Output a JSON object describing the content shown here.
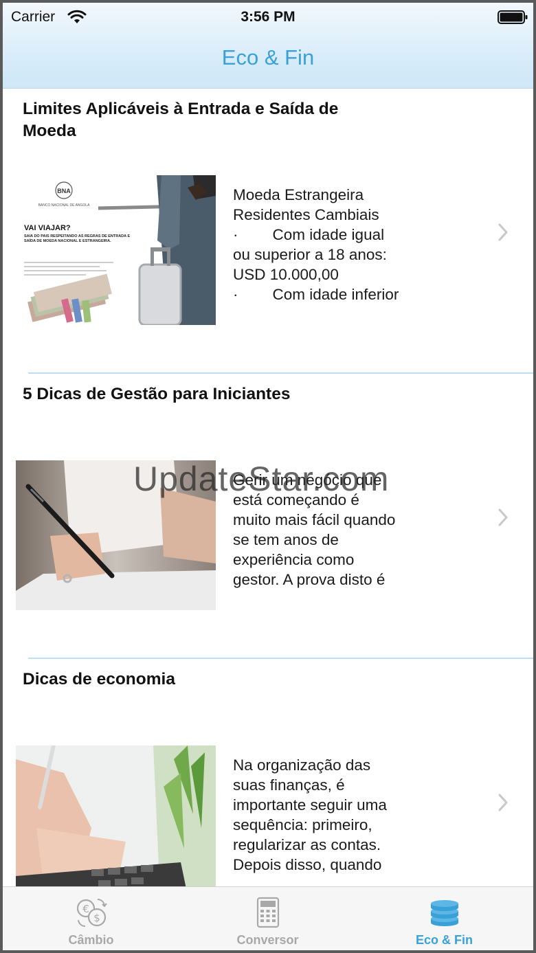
{
  "status_bar": {
    "carrier": "Carrier",
    "time": "3:56 PM"
  },
  "nav": {
    "title": "Eco & Fin"
  },
  "articles": [
    {
      "title": "Limites Aplicáveis à Entrada e Saída de Moeda",
      "excerpt": "Moeda Estrangeira\nResidentes Cambiais\n·        Com idade igual\nou superior a 18 anos:\nUSD 10.000,00\n·        Com idade inferior",
      "image": {
        "bank_name": "BNA",
        "bank_full": "BANCO NACIONAL DE ANGOLA",
        "heading": "VAI VIAJAR?",
        "subheading": "SAIA DO PAÍS RESPEITANDO AS REGRAS DE ENTRADA E SAÍDA DE MOEDA NACIONAL E ESTRANGEIRA."
      }
    },
    {
      "title": "5 Dicas de Gestão para Iniciantes",
      "excerpt": "Gerir um negócio que\nestá começando é\nmuito mais fácil quando\nse tem anos de\nexperiência como\ngestor. A prova disto é"
    },
    {
      "title": "Dicas de economia",
      "excerpt": "Na organização das\nsuas finanças, é\nimportante seguir uma\nsequência: primeiro,\nregularizar as contas.\nDepois disso, quando"
    }
  ],
  "watermark": "UpdateStar.com",
  "tabbar": {
    "tabs": [
      {
        "label": "Câmbio",
        "icon": "currency-exchange-icon",
        "active": false
      },
      {
        "label": "Conversor",
        "icon": "calculator-icon",
        "active": false
      },
      {
        "label": "Eco & Fin",
        "icon": "coins-stack-icon",
        "active": true
      }
    ]
  },
  "colors": {
    "accent": "#3aa0d8",
    "inactive_tab": "#a8a8a8",
    "separator": "#bcdff2"
  }
}
